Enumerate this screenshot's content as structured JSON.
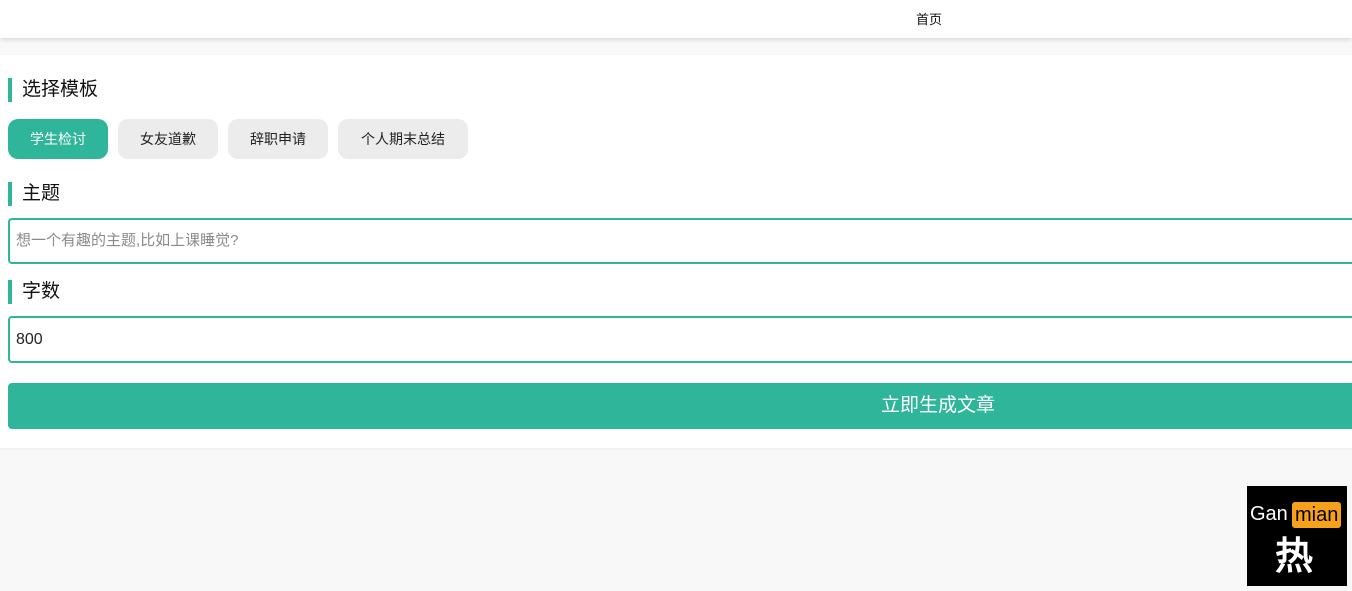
{
  "nav": {
    "home_label": "首页"
  },
  "template_section": {
    "title": "选择模板",
    "templates": [
      {
        "label": "学生检讨",
        "active": true
      },
      {
        "label": "女友道歉",
        "active": false
      },
      {
        "label": "辞职申请",
        "active": false
      },
      {
        "label": "个人期末总结",
        "active": false
      }
    ]
  },
  "topic_section": {
    "title": "主题",
    "placeholder": "想一个有趣的主题,比如上课睡觉?",
    "value": ""
  },
  "word_count_section": {
    "title": "字数",
    "value": "800"
  },
  "submit_label": "立即生成文章",
  "logo": {
    "text_left": "Gan",
    "text_highlight": "mian",
    "glyph": "热"
  },
  "colors": {
    "accent": "#2fb69a",
    "button_inactive": "#ececec",
    "logo_highlight": "#f7a11a"
  }
}
